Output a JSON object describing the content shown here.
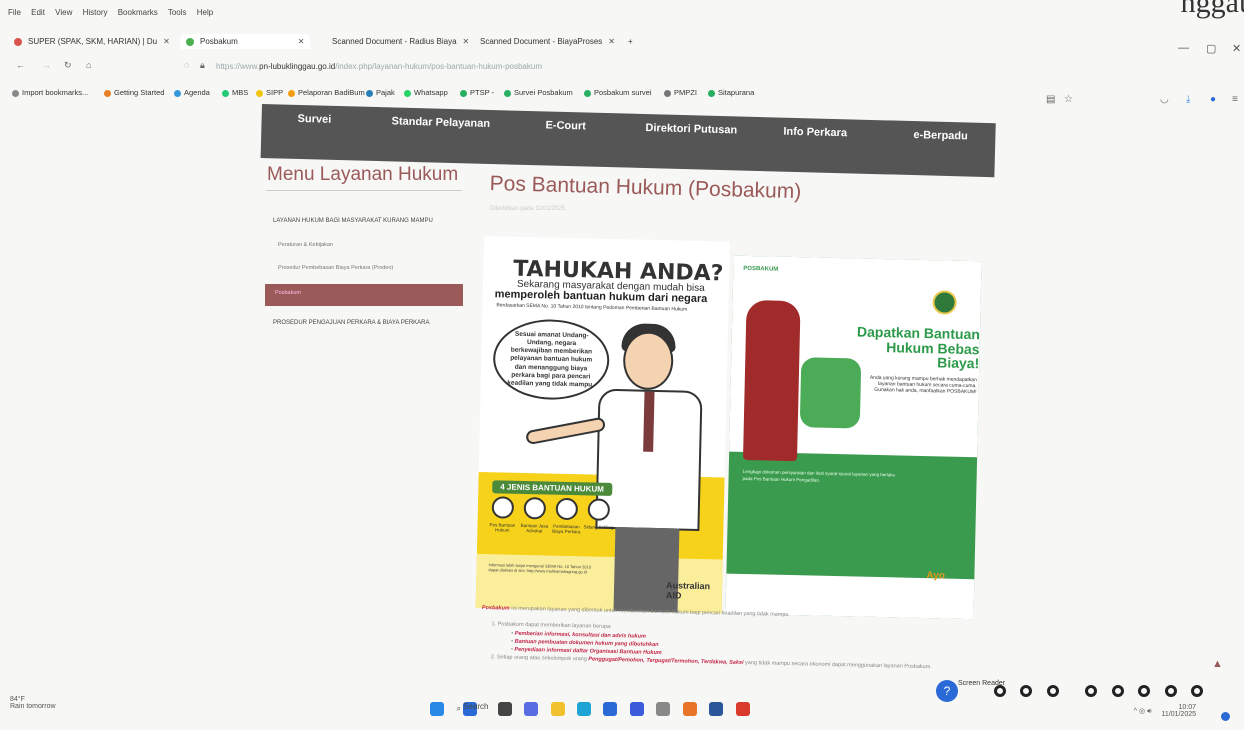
{
  "menubar": {
    "items": [
      "File",
      "Edit",
      "View",
      "History",
      "Bookmarks",
      "Tools",
      "Help"
    ]
  },
  "tabs": [
    {
      "label": "SUPER (SPAK, SKM, HARIAN) | Du"
    },
    {
      "label": "Posbakum"
    },
    {
      "label": "Scanned Document - Radius Biaya"
    },
    {
      "label": "Scanned Document - BiayaProses"
    }
  ],
  "url": {
    "faded": "https://www.",
    "domain": "pn-lubuklinggau.go.id",
    "path": "/index.php/layanan-hukum/pos-bantuan-hukum-posbakum"
  },
  "bookmarks": [
    {
      "label": "Import bookmarks...",
      "color": "#888"
    },
    {
      "label": "Getting Started",
      "color": "#e67e22"
    },
    {
      "label": "Agenda",
      "color": "#3498db"
    },
    {
      "label": "MBS",
      "color": "#2c7"
    },
    {
      "label": "SIPP",
      "color": "#f1c40f"
    },
    {
      "label": "Pelaporan BadiBum",
      "color": "#f39c12"
    },
    {
      "label": "Pajak",
      "color": "#2980b9"
    },
    {
      "label": "Whatsapp",
      "color": "#25d366"
    },
    {
      "label": "PTSP -",
      "color": "#27ae60"
    },
    {
      "label": "Survei Posbakum",
      "color": "#27ae60"
    },
    {
      "label": "Posbakum survei",
      "color": "#27ae60"
    },
    {
      "label": "PMPZI",
      "color": "#777"
    },
    {
      "label": "Sitapurana",
      "color": "#27ae60"
    }
  ],
  "site_nav": {
    "items": [
      "Survei",
      "Standar Pelayanan",
      "E-Court",
      "Direktori Putusan",
      "Info Perkara",
      "e-Berpadu"
    ]
  },
  "sidebar": {
    "title": "Menu Layanan Hukum",
    "section1": "LAYANAN HUKUM BAGI MASYARAKAT KURANG MAMPU",
    "sub1": "Peraturan & Kebijakan",
    "sub2": "Prosedur Pembebasan Biaya Perkara (Prodeo)",
    "active": "Posbakum",
    "section2": "PROSEDUR PENGAJUAN PERKARA & BIAYA PERKARA"
  },
  "page": {
    "title": "Pos Bantuan Hukum (Posbakum)",
    "date": "Diterbitkan pada 11/01/2025"
  },
  "poster": {
    "headline": "TAHUKAH ANDA?",
    "sub1": "Sekarang masyarakat dengan mudah bisa",
    "sub2": "memperoleh bantuan hukum dari negara",
    "sub3": "Berdasarkan SEMA No. 10 Tahun 2010 tentang Pedoman Pemberian Bantuan Hukum",
    "bubble": "Sesuai amanat Undang-Undang, negara berkewajiban memberikan pelayanan bantuan hukum dan menanggung biaya perkara bagi para pencari keadilan yang tidak mampu.",
    "jenis_title": "4 JENIS BANTUAN HUKUM",
    "jenis": [
      "Pos Bantuan Hukum",
      "Bantuan Jasa Advokat",
      "Pembebasan Biaya Perkara",
      "Sidang Keliling"
    ],
    "yb_text": "Informasi lebih lanjut mengenai SEMA No. 10 Tahun 2010 dapat diakses di sini: http://www.mahkamahagung.go.id",
    "ausaid": "Australian AID",
    "pos_logo": "POSBAKUM",
    "dapat": "Dapatkan Bantuan Hukum Bebas Biaya!",
    "dapat_sub": "Anda yang kurang mampu berhak mendapatkan layanan bantuan hukum secara cuma-cuma. Gunakan hak anda, manfaatkan POSBAKUM!",
    "green_text": "Lengkapi dokumen persyaratan dan ikuti syarat-syarat layanan yang berlaku pada Pos Bantuan Hukum Pengadilan.",
    "ayo": "Ayo"
  },
  "body": {
    "lead_em": "Posbakum",
    "lead": "ini merupakan layanan yang dibentuk untuk memberikan bantuan hukum bagi pencari keadilan yang tidak mampu.",
    "li1": "1. Posbakum dapat memberikan layanan berupa:",
    "b1": "Pemberian informasi, konsultasi dan advis hukum",
    "b2": "Bantuan pembuatan dokumen hukum yang dibutuhkan",
    "b3": "Penyediaan informasi daftar Organisasi Bantuan Hukum",
    "li2_pre": "2. Setiap orang atau sekelompok orang",
    "li2_em": "Penggugat/Pemohon, Tergugat/Termohon, Terdakwa, Saksi",
    "li2_post": "yang tidak mampu secara ekonomi dapat menggunakan layanan Posbakum."
  },
  "taskbar": {
    "temp": "84°F",
    "weather": "Rain tomorrow",
    "search": "Search",
    "screen_reader": "Screen Reader",
    "time": "10:07",
    "date": "11/01/2025"
  },
  "top_right_title": "nggau"
}
